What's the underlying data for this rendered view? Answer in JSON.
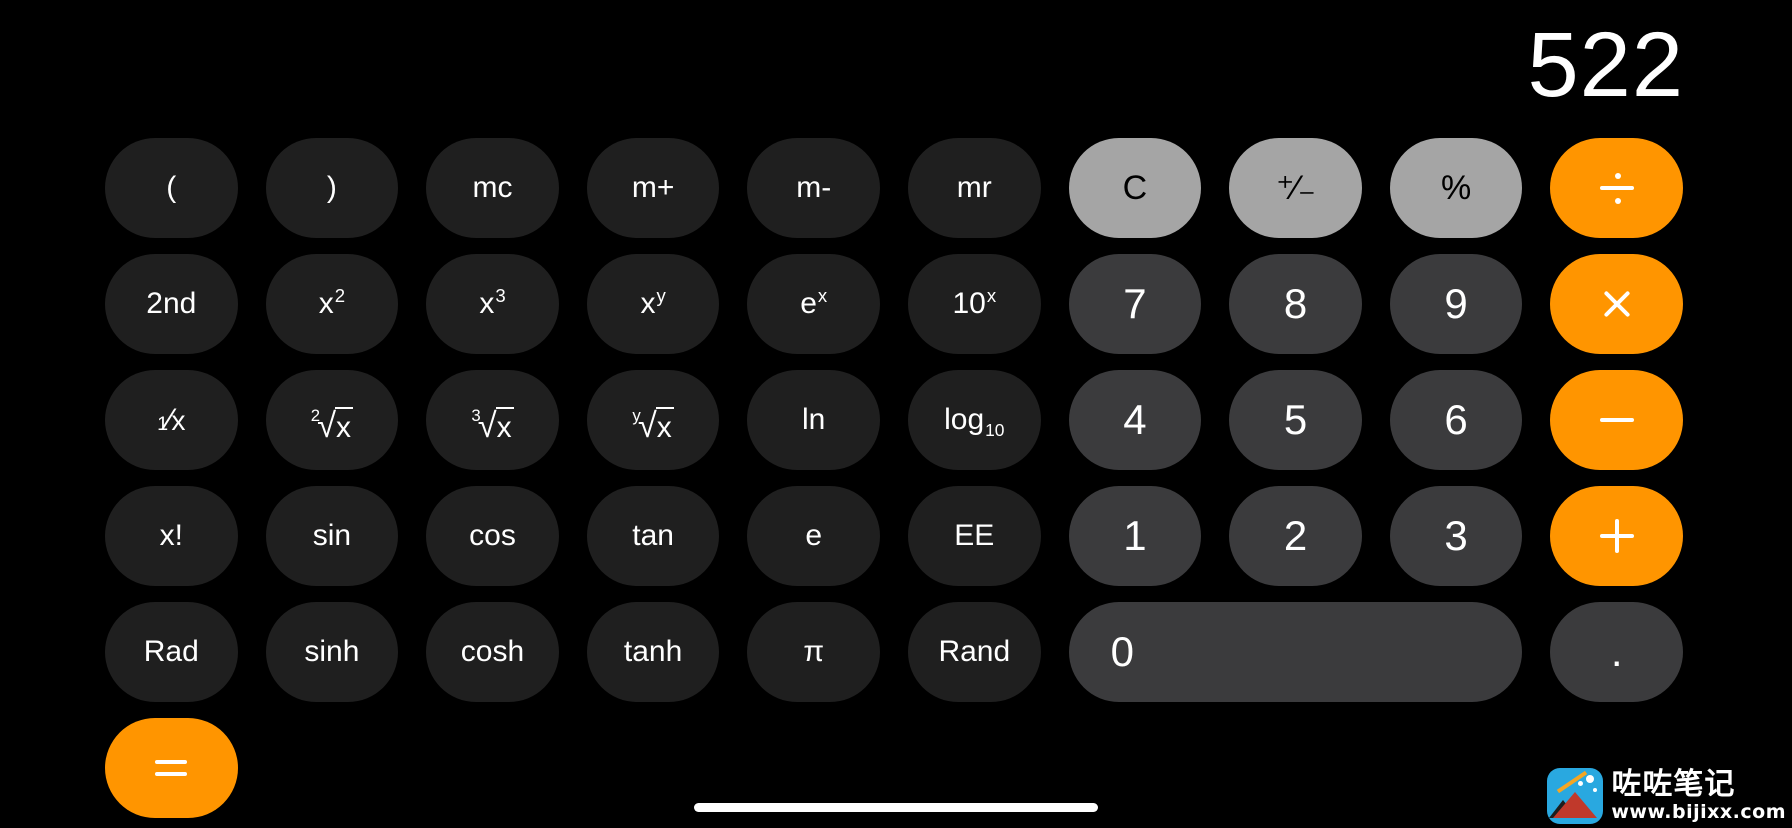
{
  "app": {
    "name": "Calculator",
    "mode": "scientific",
    "orientation": "landscape",
    "background_color": "#000000"
  },
  "display": {
    "value": "522",
    "text_color": "#ffffff"
  },
  "colors": {
    "function_key": "#1f1f1f",
    "utility_key": "#a5a5a5",
    "number_key": "#3b3b3d",
    "operator_key": "#ff9500",
    "screen_background": "#000000"
  },
  "keypad": {
    "rows": [
      [
        {
          "label": "(",
          "name": "key-open-paren",
          "style": "fn"
        },
        {
          "label": ")",
          "name": "key-close-paren",
          "style": "fn"
        },
        {
          "label": "mc",
          "name": "key-memory-clear",
          "style": "fn"
        },
        {
          "label": "m+",
          "name": "key-memory-add",
          "style": "fn"
        },
        {
          "label": "m-",
          "name": "key-memory-subtract",
          "style": "fn"
        },
        {
          "label": "mr",
          "name": "key-memory-recall",
          "style": "fn"
        },
        {
          "label": "C",
          "name": "key-clear",
          "style": "util"
        },
        {
          "label": "+/-",
          "name": "key-sign-toggle",
          "style": "util"
        },
        {
          "label": "%",
          "name": "key-percent",
          "style": "util"
        },
        {
          "label": "÷",
          "name": "key-divide",
          "style": "op"
        }
      ],
      [
        {
          "label": "2nd",
          "name": "key-second-function",
          "style": "fn"
        },
        {
          "label": "x²",
          "name": "key-square",
          "style": "fn"
        },
        {
          "label": "x³",
          "name": "key-cube",
          "style": "fn"
        },
        {
          "label": "xʸ",
          "name": "key-power-y",
          "style": "fn"
        },
        {
          "label": "eˣ",
          "name": "key-e-power-x",
          "style": "fn"
        },
        {
          "label": "10ˣ",
          "name": "key-ten-power-x",
          "style": "fn"
        },
        {
          "label": "7",
          "name": "key-7",
          "style": "num"
        },
        {
          "label": "8",
          "name": "key-8",
          "style": "num"
        },
        {
          "label": "9",
          "name": "key-9",
          "style": "num"
        },
        {
          "label": "×",
          "name": "key-multiply",
          "style": "op"
        }
      ],
      [
        {
          "label": "1/x",
          "name": "key-reciprocal",
          "style": "fn"
        },
        {
          "label": "2√x",
          "name": "key-square-root",
          "style": "fn"
        },
        {
          "label": "3√x",
          "name": "key-cube-root",
          "style": "fn"
        },
        {
          "label": "y√x",
          "name": "key-y-root",
          "style": "fn"
        },
        {
          "label": "ln",
          "name": "key-natural-log",
          "style": "fn"
        },
        {
          "label": "log10",
          "name": "key-log-base-10",
          "style": "fn"
        },
        {
          "label": "4",
          "name": "key-4",
          "style": "num"
        },
        {
          "label": "5",
          "name": "key-5",
          "style": "num"
        },
        {
          "label": "6",
          "name": "key-6",
          "style": "num"
        },
        {
          "label": "−",
          "name": "key-subtract",
          "style": "op"
        }
      ],
      [
        {
          "label": "x!",
          "name": "key-factorial",
          "style": "fn"
        },
        {
          "label": "sin",
          "name": "key-sin",
          "style": "fn"
        },
        {
          "label": "cos",
          "name": "key-cos",
          "style": "fn"
        },
        {
          "label": "tan",
          "name": "key-tan",
          "style": "fn"
        },
        {
          "label": "e",
          "name": "key-euler-number",
          "style": "fn"
        },
        {
          "label": "EE",
          "name": "key-exponent-entry",
          "style": "fn"
        },
        {
          "label": "1",
          "name": "key-1",
          "style": "num"
        },
        {
          "label": "2",
          "name": "key-2",
          "style": "num"
        },
        {
          "label": "3",
          "name": "key-3",
          "style": "num"
        },
        {
          "label": "+",
          "name": "key-add",
          "style": "op"
        }
      ],
      [
        {
          "label": "Rad",
          "name": "key-radians",
          "style": "fn"
        },
        {
          "label": "sinh",
          "name": "key-sinh",
          "style": "fn"
        },
        {
          "label": "cosh",
          "name": "key-cosh",
          "style": "fn"
        },
        {
          "label": "tanh",
          "name": "key-tanh",
          "style": "fn"
        },
        {
          "label": "π",
          "name": "key-pi",
          "style": "fn"
        },
        {
          "label": "Rand",
          "name": "key-random",
          "style": "fn"
        },
        {
          "label": "0",
          "name": "key-0",
          "style": "num wide"
        },
        {
          "label": ".",
          "name": "key-decimal-point",
          "style": "num"
        },
        {
          "label": "=",
          "name": "key-equals",
          "style": "op"
        }
      ]
    ]
  },
  "watermark": {
    "title": "咗咗笔记",
    "url": "www.bijixx.com"
  },
  "system": {
    "home_indicator": "home-indicator"
  }
}
